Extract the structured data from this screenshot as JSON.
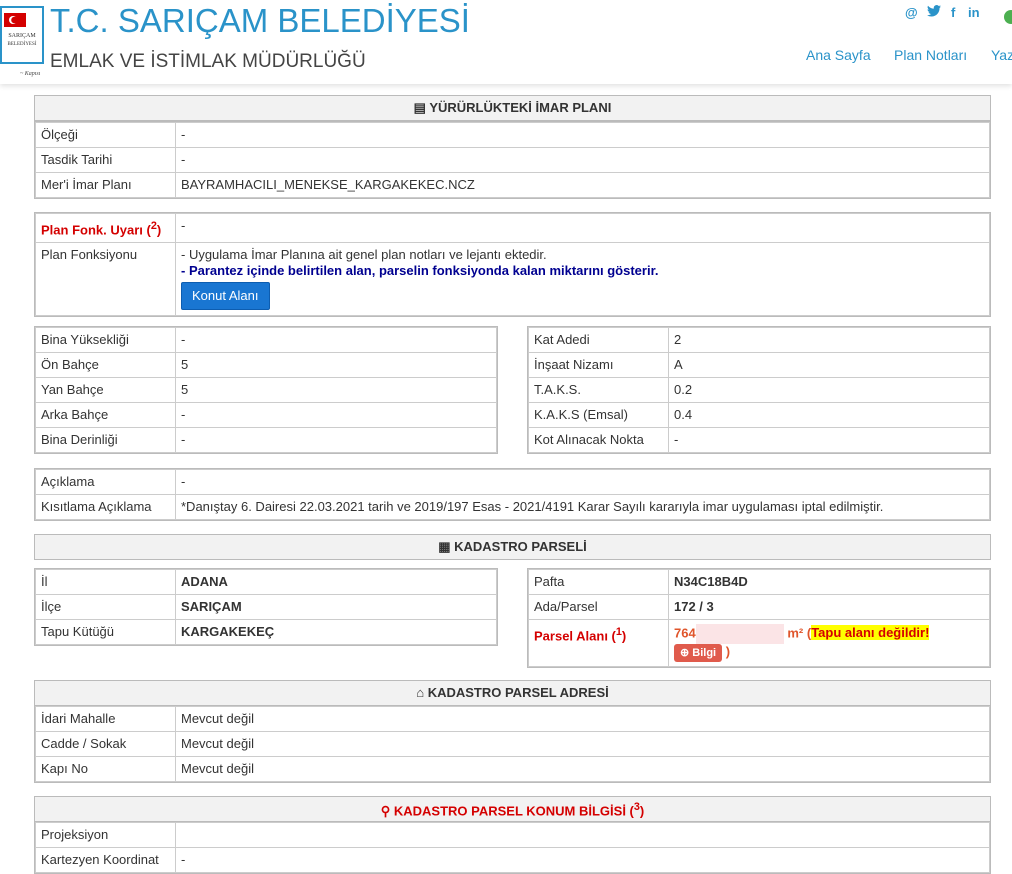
{
  "header": {
    "title": "T.C. SARIÇAM BELEDİYESİ",
    "subtitle": "EMLAK VE İSTİMLAK MÜDÜRLÜĞÜ",
    "logo_text": "SARIÇAM BELEDİYESİ",
    "nav": [
      "Ana Sayfa",
      "Plan Notları",
      "Yaz"
    ]
  },
  "imar": {
    "heading": "YÜRÜRLÜKTEKİ İMAR PLANI",
    "rows": [
      {
        "label": "Ölçeği",
        "value": "-"
      },
      {
        "label": "Tasdik Tarihi",
        "value": "-"
      },
      {
        "label": "Mer'i İmar Planı",
        "value": "BAYRAMHACILI_MENEKSE_KARGAKEKEC.NCZ"
      }
    ]
  },
  "fonk": {
    "uyari_label": "Plan Fonk. Uyarı (",
    "uyari_sup": "2",
    "uyari_close": ")",
    "uyari_value": "-",
    "label": "Plan Fonksiyonu",
    "note1": "- Uygulama İmar Planına ait genel plan notları ve lejantı ektedir.",
    "note2": "- Parantez içinde belirtilen alan, parselin fonksiyonda kalan miktarını gösterir.",
    "button": "Konut Alanı"
  },
  "left_params": [
    {
      "label": "Bina Yüksekliği",
      "value": "-"
    },
    {
      "label": "Ön Bahçe",
      "value": "5"
    },
    {
      "label": "Yan Bahçe",
      "value": "5"
    },
    {
      "label": "Arka Bahçe",
      "value": "-"
    },
    {
      "label": "Bina Derinliği",
      "value": "-"
    }
  ],
  "right_params": [
    {
      "label": "Kat Adedi",
      "value": "2"
    },
    {
      "label": "İnşaat Nizamı",
      "value": "A"
    },
    {
      "label": "T.A.K.S.",
      "value": "0.2"
    },
    {
      "label": "K.A.K.S (Emsal)",
      "value": "0.4"
    },
    {
      "label": "Kot Alınacak Nokta",
      "value": "-"
    }
  ],
  "aciklama": [
    {
      "label": "Açıklama",
      "value": "-"
    },
    {
      "label": "Kısıtlama Açıklama",
      "value": "*Danıştay 6. Dairesi 22.03.2021 tarih ve 2019/197 Esas - 2021/4191 Karar Sayılı kararıyla imar uygulaması iptal edilmiştir."
    }
  ],
  "kadastro": {
    "heading": "KADASTRO PARSELİ",
    "left": [
      {
        "label": "İl",
        "value": "ADANA"
      },
      {
        "label": "İlçe",
        "value": "SARIÇAM"
      },
      {
        "label": "Tapu Kütüğü",
        "value": "KARGAKEKEÇ"
      }
    ],
    "right": [
      {
        "label": "Pafta",
        "value": "N34C18B4D"
      },
      {
        "label": "Ada/Parsel",
        "value": "172 / 3"
      }
    ],
    "alan_label": "Parsel Alanı (",
    "alan_sup": "1",
    "alan_close": ")",
    "alan_value_prefix": "764",
    "alan_unit": "m²",
    "alan_open": "(",
    "alan_warning": "Tapu alanı değildir!",
    "bilgi": "Bilgi",
    "alan_end": ")"
  },
  "adres": {
    "heading": "KADASTRO PARSEL ADRESİ",
    "rows": [
      {
        "label": "İdari Mahalle",
        "value": "Mevcut değil"
      },
      {
        "label": "Cadde / Sokak",
        "value": "Mevcut değil"
      },
      {
        "label": "Kapı No",
        "value": "Mevcut değil"
      }
    ]
  },
  "konum": {
    "heading": "KADASTRO PARSEL KONUM BİLGİSİ (",
    "sup": "3",
    "close": ")",
    "rows": [
      {
        "label": "Projeksiyon",
        "value": ""
      },
      {
        "label": "Kartezyen Koordinat",
        "value": "-"
      }
    ]
  },
  "colors": {
    "accent": "#2a93c9",
    "button": "#1976d2",
    "warning": "#d40000"
  }
}
